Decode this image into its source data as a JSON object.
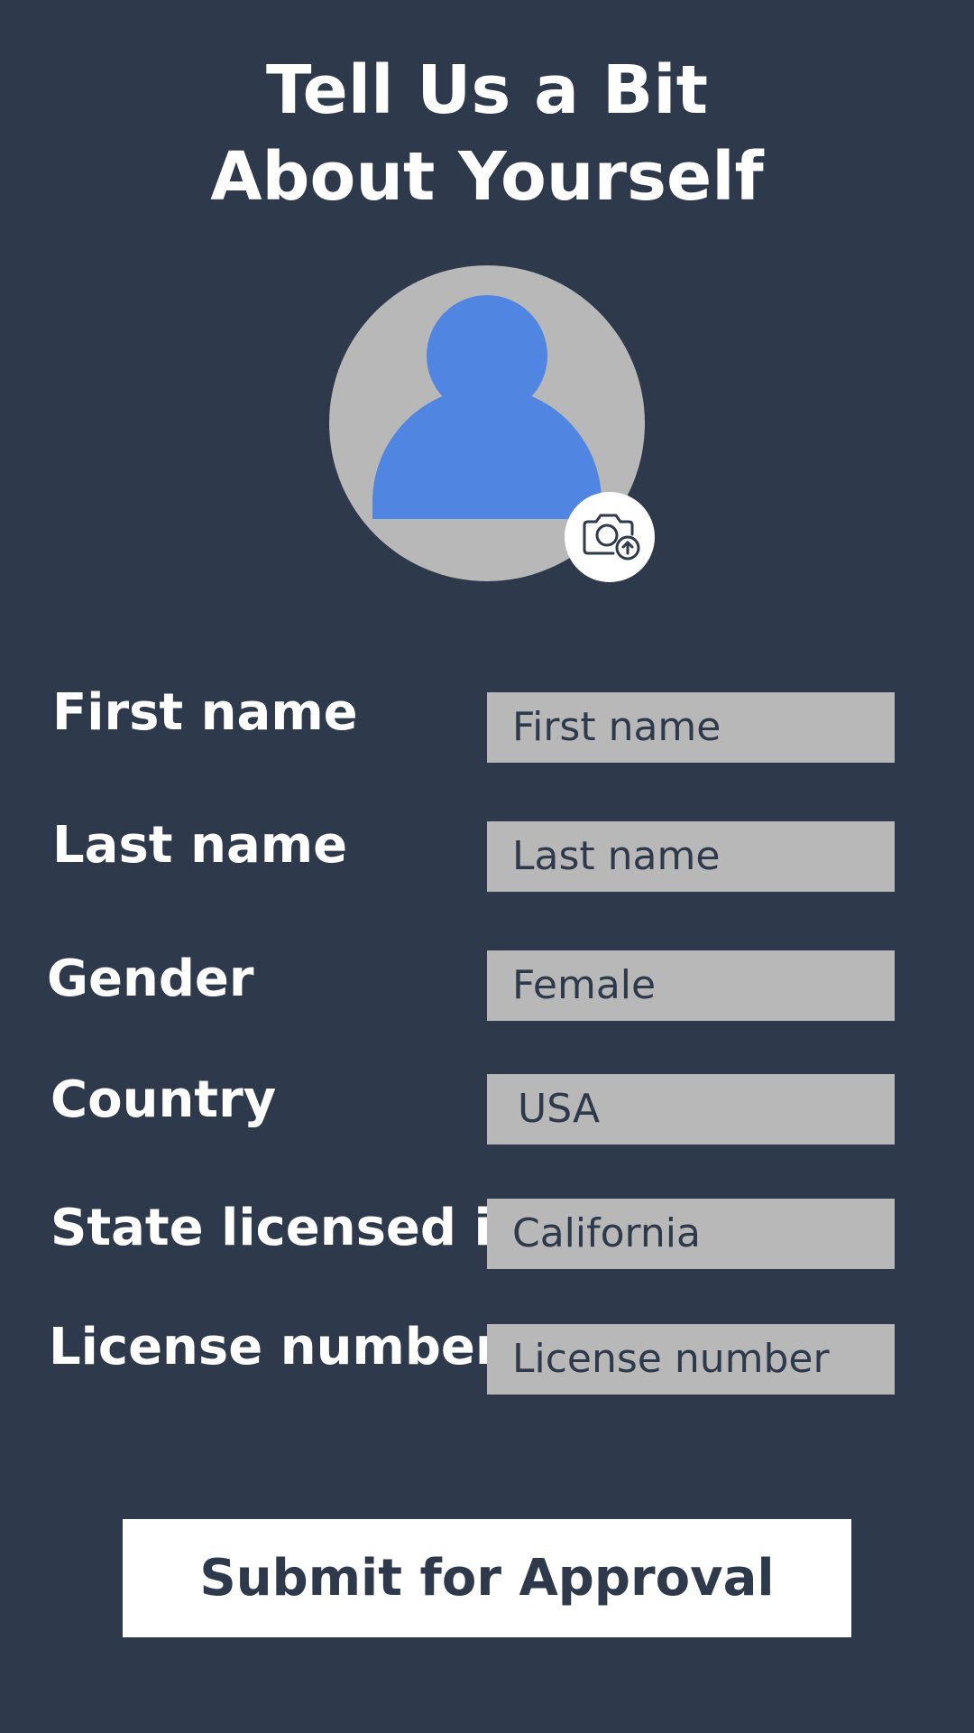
{
  "page": {
    "title_line1": "Tell Us a Bit",
    "title_line2": "About Yourself"
  },
  "colors": {
    "background": "#2e394b",
    "accent": "#5185e2",
    "field": "#b8b8b8",
    "white": "#ffffff"
  },
  "avatar": {
    "icon": "person-silhouette-icon",
    "upload_icon": "camera-upload-icon"
  },
  "form": {
    "first_name": {
      "label": "First name",
      "value": "First name"
    },
    "last_name": {
      "label": "Last name",
      "value": "Last name"
    },
    "gender": {
      "label": "Gender",
      "value": "Female"
    },
    "country": {
      "label": "Country",
      "value": "USA"
    },
    "state": {
      "label": "State licensed in",
      "value": "California"
    },
    "license_number": {
      "label": "License number",
      "value": "License number"
    }
  },
  "submit": {
    "label": "Submit for Approval"
  }
}
